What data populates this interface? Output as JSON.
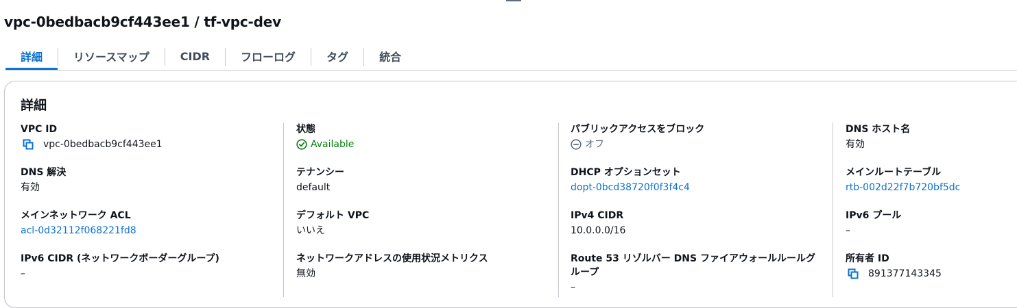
{
  "page": {
    "title": "vpc-0bedbacb9cf443ee1 / tf-vpc-dev"
  },
  "tabs": [
    {
      "label": "詳細",
      "active": true
    },
    {
      "label": "リソースマップ",
      "active": false
    },
    {
      "label": "CIDR",
      "active": false
    },
    {
      "label": "フローログ",
      "active": false
    },
    {
      "label": "タグ",
      "active": false
    },
    {
      "label": "統合",
      "active": false
    }
  ],
  "details": {
    "title": "詳細",
    "col1": {
      "vpc_id": {
        "label": "VPC ID",
        "value": "vpc-0bedbacb9cf443ee1"
      },
      "dns_resolution": {
        "label": "DNS 解決",
        "value": "有効"
      },
      "main_network_acl": {
        "label": "メインネットワーク ACL",
        "value": "acl-0d32112f068221fd8"
      },
      "ipv6_cidr": {
        "label": "IPv6 CIDR (ネットワークボーダーグループ)",
        "value": "–"
      }
    },
    "col2": {
      "state": {
        "label": "状態",
        "value": "Available"
      },
      "tenancy": {
        "label": "テナンシー",
        "value": "default"
      },
      "default_vpc": {
        "label": "デフォルト VPC",
        "value": "いいえ"
      },
      "usage_metrics": {
        "label": "ネットワークアドレスの使用状況メトリクス",
        "value": "無効"
      }
    },
    "col3": {
      "block_public_access": {
        "label": "パブリックアクセスをブロック",
        "value": "オフ"
      },
      "dhcp_options": {
        "label": "DHCP オプションセット",
        "value": "dopt-0bcd38720f0f3f4c4"
      },
      "ipv4_cidr": {
        "label": "IPv4 CIDR",
        "value": "10.0.0.0/16"
      },
      "dns_firewall": {
        "label": "Route 53 リゾルバー DNS ファイアウォールルールグループ",
        "value": "–"
      }
    },
    "col4": {
      "dns_hostnames": {
        "label": "DNS ホスト名",
        "value": "有効"
      },
      "main_route_table": {
        "label": "メインルートテーブル",
        "value": "rtb-002d22f7b720bf5dc"
      },
      "ipv6_pool": {
        "label": "IPv6 プール",
        "value": "–"
      },
      "owner_id": {
        "label": "所有者 ID",
        "value": "891377143345"
      }
    }
  },
  "colors": {
    "link": "#0972d3",
    "success": "#037f0c",
    "muted": "#5f6b7a",
    "text": "#0f141a",
    "border": "#c6c6cd"
  },
  "icons": {
    "copy": "copy-icon",
    "available": "check-circle-icon",
    "off": "minus-circle-icon"
  }
}
